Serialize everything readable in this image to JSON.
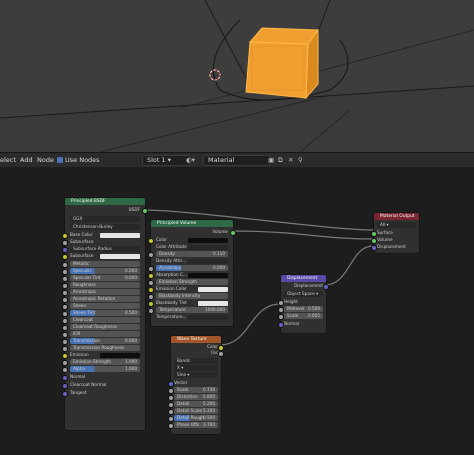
{
  "header": {
    "menus": [
      "elect",
      "Add",
      "Node"
    ],
    "use_nodes_label": "Use Nodes",
    "slot": "Slot 1",
    "material_name": "Material"
  },
  "colors": {
    "bsdf_header": "#2d6a45",
    "volume_header": "#2d6a45",
    "output_header": "#7a2430",
    "displacement_header": "#5a4aa8",
    "wave_header": "#a2562a",
    "shader_socket": "#63c763",
    "color_socket": "#c7c729",
    "vector_socket": "#6363c7",
    "float_socket": "#a1a1a1"
  },
  "bsdf": {
    "title": "Principled BSDF",
    "output": "BSDF",
    "distribution": "GGX",
    "sss_method": "Christensen-Burley",
    "base_color": "Base Color",
    "subsurface": "Subsurface",
    "subsurface_radius": "Subsurface Radius",
    "subsurface_color": "Subsurface",
    "metallic": "Metallic",
    "specular": "Specular",
    "specular_val": "0.500",
    "specular_tint": "Specular Tint",
    "specular_tint_val": "0.000",
    "roughness": "Roughness",
    "anisotropic": "Anisotropic",
    "anisotropic_rotation": "Anisotropic Rotation",
    "sheen": "Sheen",
    "sheen_tint": "Sheen Tint",
    "sheen_tint_val": "0.500",
    "clearcoat": "Clearcoat",
    "clearcoat_roughness": "Clearcoat Roughness",
    "ior": "IOR",
    "transmission": "Transmission",
    "transmission_val": "0.000",
    "transmission_roughness": "Transmission Roughness",
    "emission": "Emission",
    "emission_strength": "Emission Strength",
    "emission_strength_val": "1.000",
    "alpha": "Alpha",
    "alpha_val": "1.000",
    "normal": "Normal",
    "clearcoat_normal": "Clearcoat Normal",
    "tangent": "Tangent"
  },
  "volume": {
    "title": "Principled Volume",
    "output": "Volume",
    "color": "Color",
    "color_attribute": "Color Attribute",
    "density": "Density",
    "density_val": "0.110",
    "density_attr": "Density Attri...",
    "anisotropy": "Anisotropy",
    "anisotropy_val": "0.000",
    "absorption": "Absorption C...",
    "emission_strength": "Emission Strength",
    "emission_color": "Emission Color",
    "blackbody_intensity": "Blackbody Intensity",
    "blackbody_tint": "Blackbody Tint",
    "temperature": "Temperature",
    "temperature_val": "1000.000",
    "temperature_attr": "Temperature..."
  },
  "output": {
    "title": "Material Output",
    "target": "All",
    "surface": "Surface",
    "volume": "Volume",
    "displacement": "Displacement"
  },
  "displacement": {
    "title": "Displacement",
    "output": "Displacement",
    "space": "Object Space",
    "height": "Height",
    "midlevel": "Midlevel",
    "midlevel_val": "0.500",
    "scale": "Scale",
    "scale_val": "0.055",
    "normal": "Normal"
  },
  "wave": {
    "title": "Wave Texture",
    "color": "Color",
    "fac": "Fac",
    "type": "Bands",
    "direction": "X",
    "profile": "Sine",
    "vector": "Vector",
    "scale": "Scale",
    "scale_val": "0.730",
    "distortion": "Distortion",
    "distortion_val": "5.800",
    "detail": "Detail",
    "detail_val": "5.200",
    "detail_scale": "Detail Scale",
    "detail_scale_val": "5.200",
    "detail_rough": "Detail Rough",
    "detail_rough_val": "0.500",
    "phase": "Phase Offs",
    "phase_val": "3.700"
  }
}
